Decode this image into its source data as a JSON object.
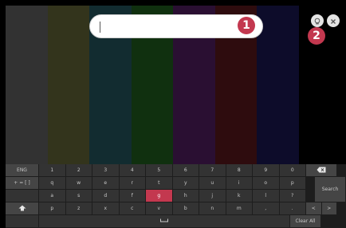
{
  "colors": {
    "bars": [
      "#323232",
      "#33341c",
      "#122c30",
      "#10300f",
      "#2a0f32",
      "#2e0c0e",
      "#0d0c2a",
      "#000000"
    ],
    "accent": "#c3384f"
  },
  "search": {
    "value": "",
    "placeholder": ""
  },
  "badges": {
    "search_field": "1",
    "voice_search": "2"
  },
  "icons": {
    "voice": "voice-search-icon",
    "close": "close-icon",
    "backspace": "backspace-icon",
    "shift": "shift-icon",
    "space": "space-icon"
  },
  "keyboard": {
    "language": "ENG",
    "symbols": "+ = [ ]",
    "search_label": "Search",
    "clear_all_label": "Clear All",
    "arrow_left": "<",
    "arrow_right": ">",
    "selected_key": "g",
    "row1": [
      "1",
      "2",
      "3",
      "4",
      "5",
      "6",
      "7",
      "8",
      "9",
      "0"
    ],
    "row2": [
      "q",
      "w",
      "e",
      "r",
      "t",
      "y",
      "u",
      "i",
      "o",
      "p"
    ],
    "row3": [
      "a",
      "s",
      "d",
      "f",
      "g",
      "h",
      "j",
      "k",
      "l",
      "?"
    ],
    "row4": [
      "p",
      "z",
      "x",
      "c",
      "v",
      "b",
      "n",
      "m",
      ",",
      "."
    ]
  }
}
